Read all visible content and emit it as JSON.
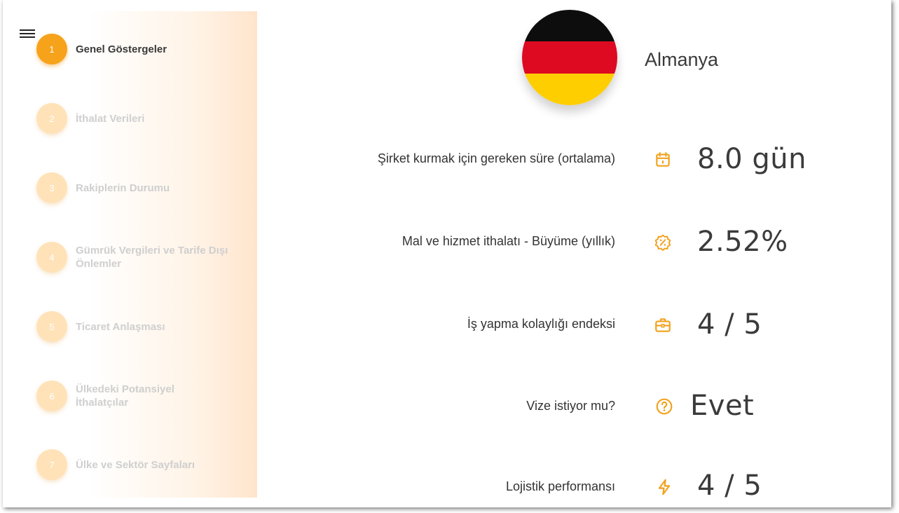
{
  "sidebar": {
    "menu_icon": "hamburger-menu-icon",
    "steps": [
      {
        "number": "1",
        "label": "Genel Göstergeler",
        "active": true
      },
      {
        "number": "2",
        "label": "İthalat Verileri",
        "active": false
      },
      {
        "number": "3",
        "label": "Rakiplerin Durumu",
        "active": false
      },
      {
        "number": "4",
        "label": "Gümrük Vergileri ve Tarife Dışı Önlemler",
        "active": false
      },
      {
        "number": "5",
        "label": "Ticaret Anlaşması",
        "active": false
      },
      {
        "number": "6",
        "label": "Ülkedeki Potansiyel İthalatçılar",
        "active": false
      },
      {
        "number": "7",
        "label": "Ülke ve Sektör Sayfaları",
        "active": false
      }
    ]
  },
  "country": {
    "name": "Almanya",
    "flag_colors": [
      "#0d0d0d",
      "#dd0a22",
      "#ffce00"
    ]
  },
  "metrics": [
    {
      "label": "Şirket kurmak için gereken süre (ortalama)",
      "value": "8.0 gün",
      "icon": "calendar-icon"
    },
    {
      "label": "Mal ve hizmet ithalatı - Büyüme (yıllık)",
      "value": "2.52%",
      "icon": "percent-badge-icon"
    },
    {
      "label": "İş yapma kolaylığı endeksi",
      "value": "4 / 5",
      "icon": "briefcase-icon"
    },
    {
      "label": "Vize istiyor mu?",
      "value": "Evet",
      "icon": "question-circle-icon"
    },
    {
      "label": "Lojistik performansı",
      "value": "4 / 5",
      "icon": "lightning-icon"
    }
  ],
  "colors": {
    "accent": "#f7a21b",
    "inactive_step": "#ffe2b8",
    "inactive_text": "#cfcfcf",
    "icon": "#f2a21d"
  }
}
